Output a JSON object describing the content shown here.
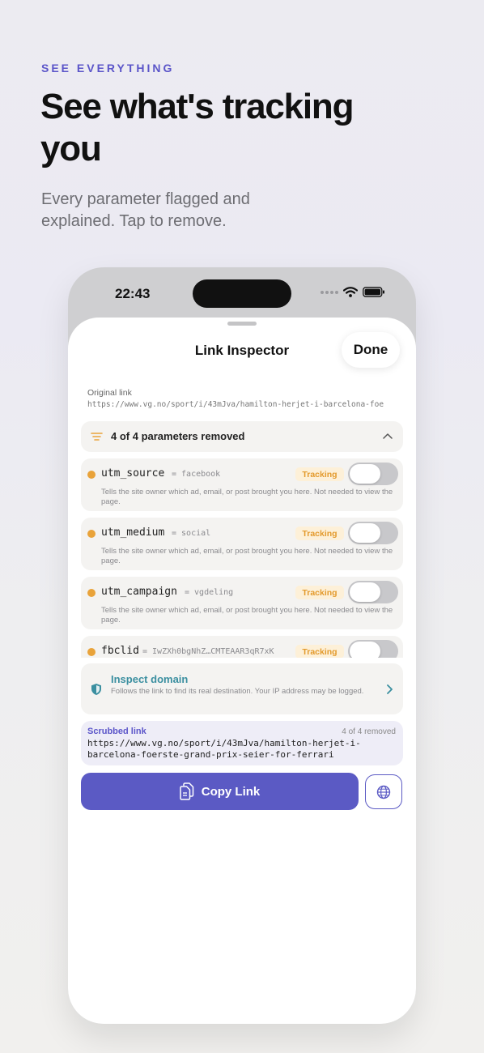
{
  "marketing": {
    "eyebrow": "SEE EVERYTHING",
    "headline": "See what's tracking you",
    "subhead": "Every parameter flagged and explained. Tap to remove."
  },
  "status_bar": {
    "time": "22:43"
  },
  "sheet": {
    "title": "Link Inspector",
    "done_label": "Done"
  },
  "original_link": {
    "label": "Original link",
    "url": "https://www.vg.no/sport/i/43mJva/hamilton-herjet-i-barcelona-foe"
  },
  "summary": {
    "text": "4 of 4 parameters removed"
  },
  "parameters": [
    {
      "name": "utm_source",
      "value": "= facebook",
      "badge": "Tracking",
      "enabled": false,
      "description": "Tells the site owner which ad, email, or post brought you here. Not needed to view the page."
    },
    {
      "name": "utm_medium",
      "value": "= social",
      "badge": "Tracking",
      "enabled": false,
      "description": "Tells the site owner which ad, email, or post brought you here. Not needed to view the page."
    },
    {
      "name": "utm_campaign",
      "value": "= vgdeling",
      "badge": "Tracking",
      "enabled": false,
      "description": "Tells the site owner which ad, email, or post brought you here. Not needed to view the page."
    },
    {
      "name": "fbclid",
      "value": "= IwZXh0bgNhZ…CMTEAAR3qR7xK",
      "badge": "Tracking",
      "enabled": false,
      "description": ""
    }
  ],
  "inspect_domain": {
    "title": "Inspect domain",
    "description": "Follows the link to find its real destination. Your IP address may be logged."
  },
  "scrubbed_link": {
    "label": "Scrubbed link",
    "count": "4 of 4 removed",
    "url": "https://www.vg.no/sport/i/43mJva/hamilton-herjet-i-barcelona-foerste-grand-prix-seier-for-ferrari"
  },
  "actions": {
    "copy_label": "Copy Link"
  },
  "colors": {
    "accent": "#5b5ac4",
    "tracking": "#e9a33a",
    "inspect": "#3b8fa0",
    "eyebrow": "#5b55c9"
  },
  "icons": {
    "summary": "filter-lines-icon",
    "collapse": "chevron-up-icon",
    "inspect": "shield-icon",
    "inspect_action": "chevron-right-icon",
    "copy": "copy-document-icon",
    "open": "globe-icon"
  }
}
